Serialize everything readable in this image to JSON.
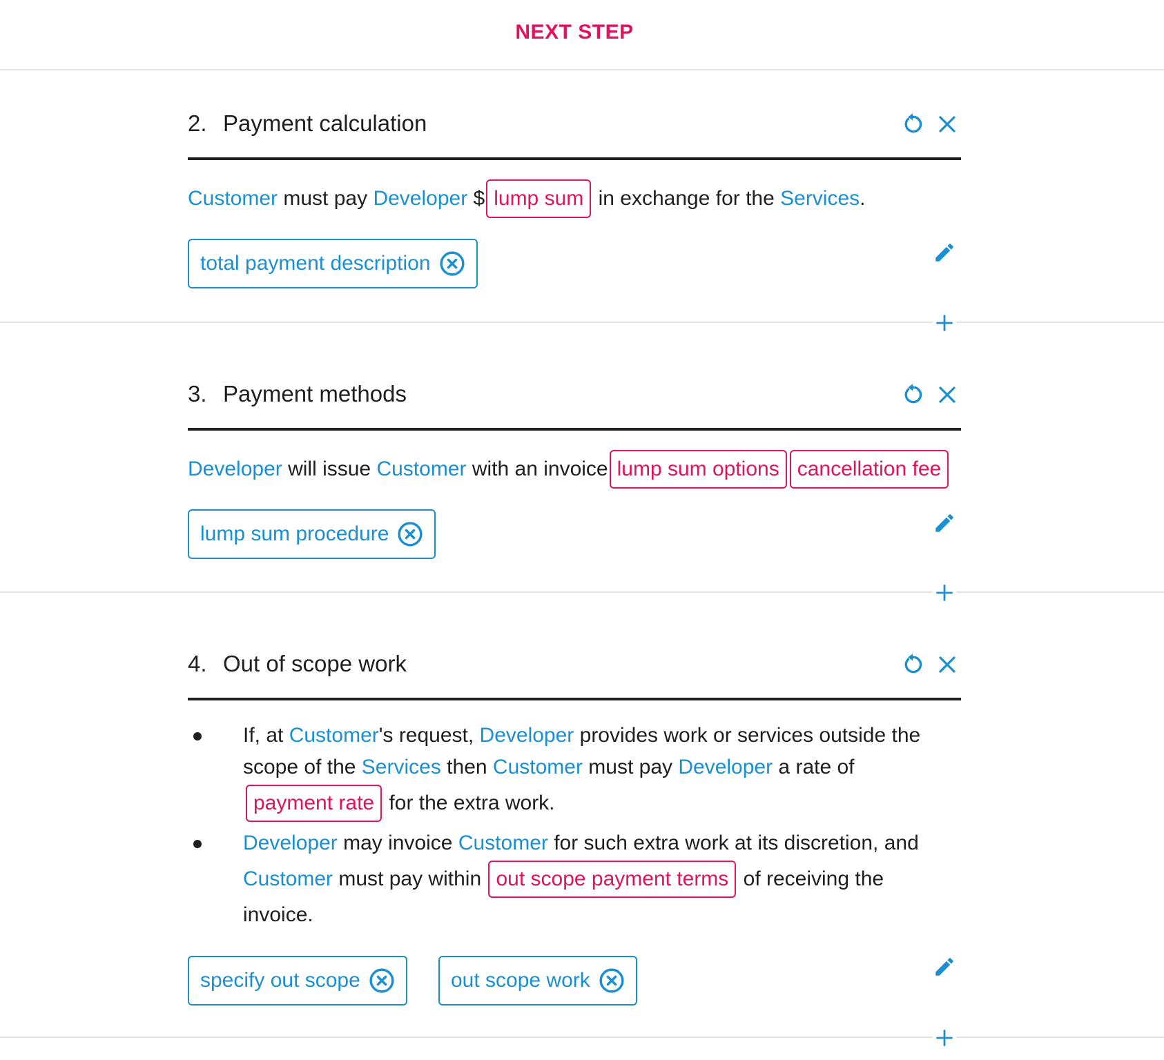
{
  "header": {
    "next_step": "NEXT STEP"
  },
  "roles": {
    "customer": "Customer",
    "developer": "Developer",
    "services": "Services"
  },
  "sections": [
    {
      "number": "2.",
      "title": "Payment calculation",
      "text": {
        "must_pay": " must pay ",
        "dollar": " $",
        "var_lump_sum": "lump sum",
        "in_exchange": " in exchange for the ",
        "period": "."
      },
      "chips": [
        "total payment description"
      ]
    },
    {
      "number": "3.",
      "title": "Payment methods",
      "text": {
        "will_issue": " will issue ",
        "with_invoice": " with an invoice",
        "var_lump_sum_options": "lump sum options",
        "var_cancellation_fee": "cancellation fee"
      },
      "chips": [
        "lump sum procedure"
      ]
    },
    {
      "number": "4.",
      "title": "Out of scope work",
      "bullets": {
        "b1_a": "If, at ",
        "b1_b": "'s request, ",
        "b1_c": " provides work or services outside the",
        "b1_d": "scope of the ",
        "b1_e": " then ",
        "b1_f": " must pay ",
        "b1_g": " a rate of",
        "var_payment_rate": "payment rate",
        "b1_h": " for the extra work.",
        "b2_a": " may invoice ",
        "b2_b": " for such extra work at its discretion, and",
        "b2_c": " must pay within ",
        "var_out_scope_payment_terms": "out scope payment terms",
        "b2_d": " of receiving the",
        "b2_e": "invoice."
      },
      "chips": [
        "specify out scope",
        "out scope work"
      ]
    }
  ],
  "colors": {
    "accent_blue": "#1a8fd1",
    "accent_pink": "#e0135e",
    "text": "#1f1f1f",
    "divider": "#e3e3e3"
  },
  "icons": [
    "reset-icon",
    "close-icon",
    "pencil-icon",
    "plus-icon",
    "remove-circle-icon"
  ]
}
